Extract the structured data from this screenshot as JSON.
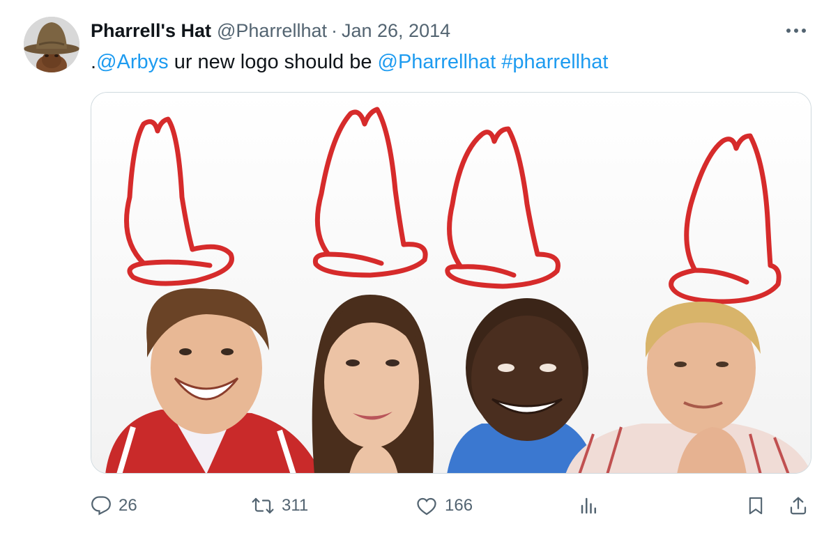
{
  "tweet": {
    "author_name": "Pharrell's Hat",
    "author_handle": "@Pharrellhat",
    "separator": "·",
    "date": "Jan 26, 2014",
    "more_icon": "more-horizontal-icon",
    "text": {
      "prefix": ".",
      "mention1": "@Arbys",
      "middle": " ur new logo should be ",
      "mention2": "@Pharrellhat",
      "space": " ",
      "hashtag": "#pharrellhat"
    },
    "link_color": "#1d9bf0",
    "media": {
      "hat_color": "#d62b2b",
      "people_count_note": null
    },
    "actions": {
      "reply_count": "26",
      "retweet_count": "311",
      "like_count": "166",
      "reply_icon": "reply-icon",
      "retweet_icon": "retweet-icon",
      "like_icon": "heart-icon",
      "views_icon": "views-chart-icon",
      "bookmark_icon": "bookmark-icon",
      "share_icon": "share-icon"
    }
  }
}
